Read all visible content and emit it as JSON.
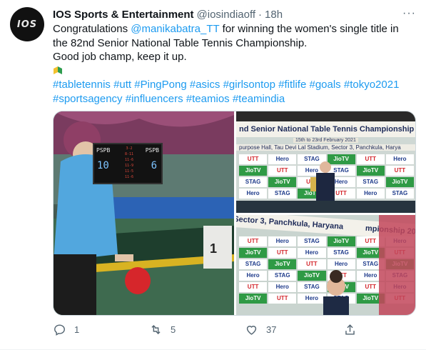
{
  "tweet": {
    "avatar_text": "IOS",
    "author_name": "IOS Sports & Entertainment",
    "handle": "@iosindiaoff",
    "separator": "·",
    "time": "18h",
    "more": "···",
    "body": {
      "line1_pre": "Congratulations ",
      "mention": "@manikabatra_TT",
      "line1_post": " for winning the women's single title in",
      "line2": "the 82nd Senior National Table Tennis Championship.",
      "line3": "Good job champ, keep it up.",
      "hashtags_row1": [
        "#tabletennis",
        "#utt",
        "#PingPong",
        "#asics",
        "#girlsontop",
        "#fitlife",
        "#goals",
        "#tokyo2021"
      ],
      "hashtags_row2": [
        "#sportsagency",
        "#influencers",
        "#teamios",
        "#teamindia"
      ]
    },
    "media": {
      "scoreboard": {
        "team_left": "PSPB",
        "team_right": "PSPB",
        "score_left": "10",
        "score_right": "6",
        "sets": [
          "3-2",
          "8-11",
          "11-6",
          "11-9",
          "11-5",
          "11-6"
        ]
      },
      "court_number": "1",
      "banner_top": "nd Senior National Table Tennis Championship 2",
      "banner_top_dates": "15th to 23rd February 2021",
      "banner_top_venue": "purpose Hall, Tau Devi Lal Stadium, Sector 3, Panchkula, Harya",
      "banner_bottom": "Sector 3, Panchkula, Haryana",
      "banner_bottom_right": "mpionship 2020",
      "sponsors": [
        "UTT",
        "Hero",
        "STAG",
        "JioTV"
      ]
    },
    "actions": {
      "reply_count": "1",
      "retweet_count": "5",
      "like_count": "37"
    },
    "colors": {
      "link": "#1d9bf0",
      "secondary": "#536471"
    }
  }
}
